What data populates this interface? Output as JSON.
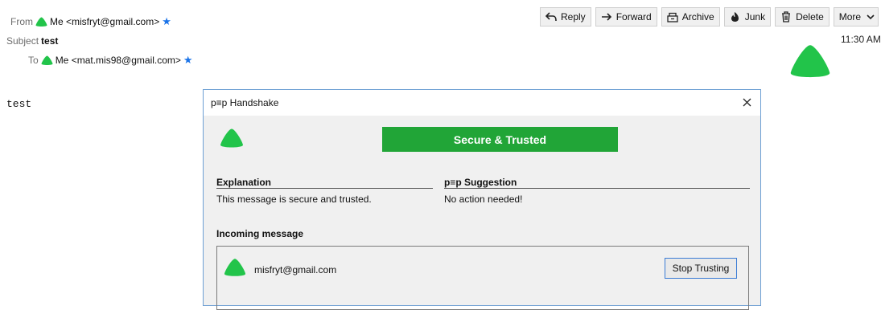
{
  "header": {
    "from_label": "From",
    "from_value": "Me <misfryt@gmail.com>",
    "subject_label": "Subject",
    "subject_value": "test",
    "to_label": "To",
    "to_value": "Me <mat.mis98@gmail.com>",
    "date": "11:30 AM"
  },
  "toolbar": {
    "reply": "Reply",
    "forward": "Forward",
    "archive": "Archive",
    "junk": "Junk",
    "delete": "Delete",
    "more": "More"
  },
  "message": {
    "body": "test"
  },
  "dialog": {
    "title": "p≡p Handshake",
    "status": "Secure & Trusted",
    "explanation_heading": "Explanation",
    "explanation_text": "This message is secure and trusted.",
    "suggestion_heading": "p≡p Suggestion",
    "suggestion_text": "No action needed!",
    "incoming_heading": "Incoming message",
    "incoming_address": "misfryt@gmail.com",
    "stop_trusting_label": "Stop Trusting"
  },
  "colors": {
    "pep_green": "#22c44a",
    "status_banner": "#21a537",
    "star_blue": "#1a73e8"
  },
  "icons": [
    "pep-trusted-icon",
    "star-icon",
    "reply-icon",
    "forward-icon",
    "archive-icon",
    "junk-icon",
    "delete-icon",
    "chevron-down-icon",
    "close-icon"
  ]
}
